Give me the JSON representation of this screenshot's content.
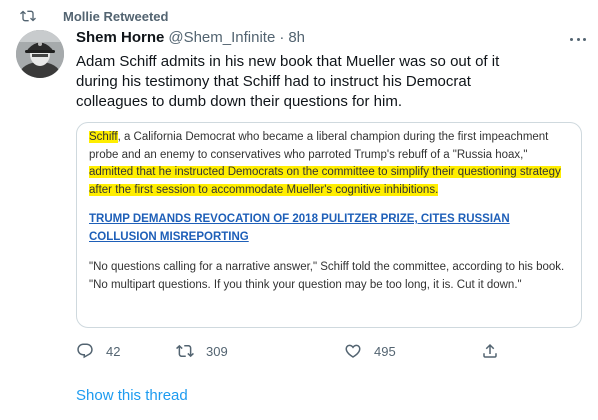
{
  "retweet_context": {
    "label": "Mollie Retweeted"
  },
  "tweet": {
    "display_name": "Shem Horne",
    "handle": "@Shem_Infinite",
    "separator": "·",
    "time": "8h",
    "text": "Adam Schiff admits in his new book that Mueller was so out of it during his testimony that Schiff had to instruct his Democrat colleagues to dumb down their questions for him."
  },
  "quote": {
    "p1_hl1": "Schiff",
    "p1_t1": ", a California Democrat who became a liberal champion during the first impeachment probe and an enemy to conservatives who parroted Trump's rebuff of a \"Russia hoax,\"",
    "p1_hl2": " admitted that he instructed Democrats on the committee to simplify their questioning strategy after the first session to accommodate Mueller's cognitive inhibitions.",
    "headline": "TRUMP DEMANDS REVOCATION OF 2018 PULITZER PRIZE, CITES RUSSIAN COLLUSION MISREPORTING",
    "p2": "\"No questions calling for a narrative answer,\" Schiff told the committee, according to his book. \"No multipart questions. If you think your question may be too long, it is. Cut it down.\""
  },
  "actions": {
    "replies": "42",
    "retweets": "309",
    "likes": "495"
  },
  "show_thread": "Show this thread",
  "colors": {
    "highlight": "#ffee00",
    "link": "#1d9bf0",
    "headline_link": "#1e5fb8",
    "secondary_text": "#536471"
  },
  "icons": [
    "retweet-icon",
    "more-icon",
    "reply-icon",
    "retweet-icon",
    "like-icon",
    "share-icon"
  ]
}
